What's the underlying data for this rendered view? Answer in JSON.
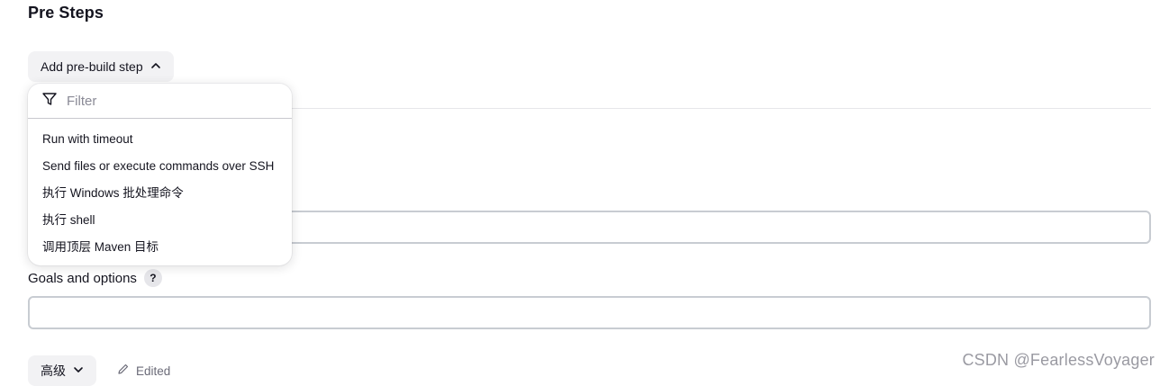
{
  "section": {
    "title": "Pre Steps"
  },
  "add_button": {
    "label": "Add pre-build step",
    "icon": "chevron-up-icon"
  },
  "dropdown": {
    "filter_placeholder": "Filter",
    "filter_icon": "filter-icon",
    "items": [
      {
        "label": "Run with timeout"
      },
      {
        "label": "Send files or execute commands over SSH"
      },
      {
        "label": "执行 Windows 批处理命令"
      },
      {
        "label": "执行 shell"
      },
      {
        "label": "调用顶层 Maven 目标"
      }
    ]
  },
  "goals": {
    "label": "Goals and options",
    "help": "?",
    "value": ""
  },
  "version_field": {
    "value": ""
  },
  "advanced": {
    "label": "高级",
    "icon": "chevron-down-icon"
  },
  "edited": {
    "label": "Edited",
    "icon": "pencil-icon"
  },
  "watermark": {
    "text": "CSDN @FearlessVoyager"
  },
  "colors": {
    "text": "#14141f",
    "button_bg": "#f2f2f4",
    "border": "#c8ccd2",
    "muted": "#6b6b78"
  }
}
